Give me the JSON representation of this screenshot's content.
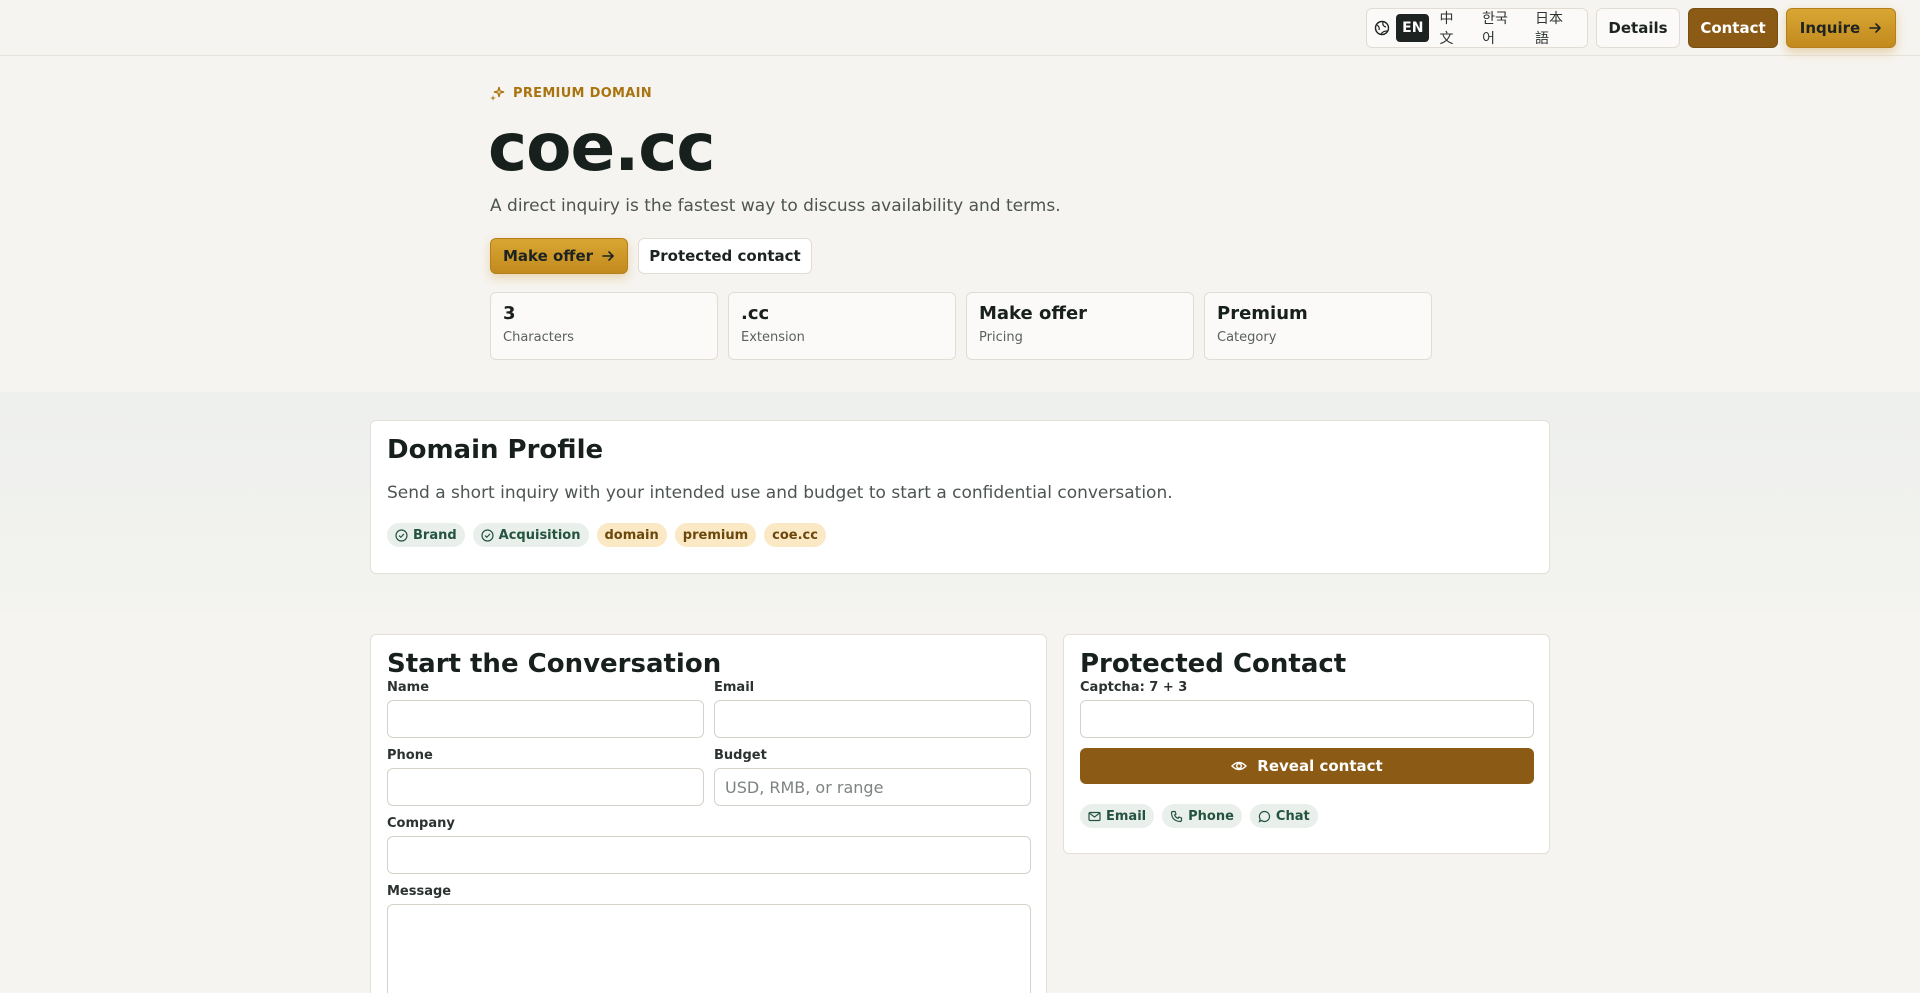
{
  "header": {
    "languages": [
      "EN",
      "中文",
      "한국어",
      "日本語"
    ],
    "active_language": "EN",
    "details_label": "Details",
    "contact_label": "Contact",
    "inquire_label": "Inquire"
  },
  "hero": {
    "eyebrow": "PREMIUM DOMAIN",
    "title": "coe.cc",
    "subtitle": "A direct inquiry is the fastest way to discuss availability and terms.",
    "offer_button": "Make offer",
    "protected_button": "Protected contact",
    "stats": [
      {
        "value": "3",
        "label": "Characters"
      },
      {
        "value": ".cc",
        "label": "Extension"
      },
      {
        "value": "Make offer",
        "label": "Pricing"
      },
      {
        "value": "Premium",
        "label": "Category"
      }
    ]
  },
  "profile": {
    "title": "Domain Profile",
    "description": "Send a short inquiry with your intended use and budget to start a confidential conversation.",
    "tags": [
      {
        "label": "Brand",
        "icon": "check-circle-icon"
      },
      {
        "label": "Acquisition",
        "icon": "check-circle-icon"
      },
      {
        "label": "domain"
      },
      {
        "label": "premium"
      },
      {
        "label": "coe.cc"
      }
    ]
  },
  "form": {
    "title": "Start the Conversation",
    "name_label": "Name",
    "email_label": "Email",
    "phone_label": "Phone",
    "budget_label": "Budget",
    "budget_placeholder": "USD, RMB, or range",
    "company_label": "Company",
    "message_label": "Message"
  },
  "contact": {
    "title": "Protected Contact",
    "captcha_label": "Captcha: 7 + 3",
    "reveal_button": "Reveal contact",
    "chips": [
      "Email",
      "Phone",
      "Chat"
    ]
  },
  "colors": {
    "accent_gold": "#c28a1e",
    "accent_brown": "#8b5a14",
    "tag_green_bg": "#e9efea",
    "tag_gold_bg": "#fbe8c4"
  }
}
